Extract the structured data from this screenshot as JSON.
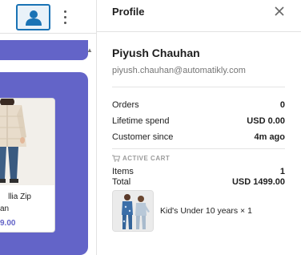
{
  "topbar": {
    "account_icon": "user-icon",
    "menu_icon": "kebab-menu-icon"
  },
  "product_card": {
    "name_line1": "llia Zip",
    "name_line2": "an",
    "price": "9.00"
  },
  "panel": {
    "title": "Profile",
    "close_icon": "close-icon",
    "customer": {
      "name": "Piyush Chauhan",
      "email": "piyush.chauhan@automatikly.com"
    },
    "stats": [
      {
        "label": "Orders",
        "value": "0"
      },
      {
        "label": "Lifetime spend",
        "value": "USD 0.00"
      },
      {
        "label": "Customer since",
        "value": "4m ago"
      }
    ],
    "cart": {
      "heading": "ACTIVE CART",
      "icon": "cart-icon",
      "items_label": "Items",
      "items_value": "1",
      "total_label": "Total",
      "total_value": "USD 1499.00",
      "item": {
        "description": "Kid's Under 10 years × 1"
      }
    }
  },
  "colors": {
    "accent": "#6364c8",
    "focus_border": "#1a73b5",
    "muted_text": "#757575"
  }
}
